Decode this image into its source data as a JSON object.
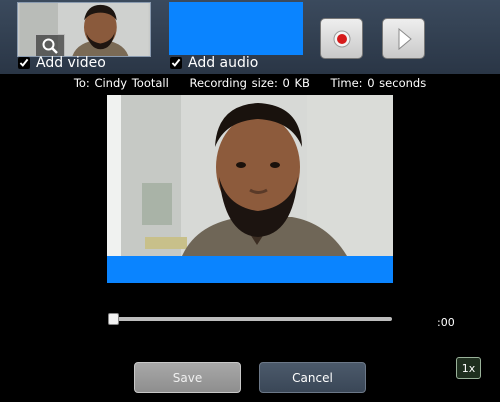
{
  "toolbar": {
    "add_video_label": "Add video",
    "add_audio_label": "Add audio",
    "add_video_checked": true,
    "add_audio_checked": true,
    "record_icon": "record-icon",
    "play_icon": "play-icon",
    "zoom_icon": "magnifier-icon"
  },
  "status": {
    "to": "To: Cindy Tootall",
    "size": "Recording size: 0 KB",
    "time": "Time: 0 seconds"
  },
  "player": {
    "time_label": ":00",
    "speed_label": "1x",
    "seek_progress": 0
  },
  "actions": {
    "save_label": "Save",
    "cancel_label": "Cancel"
  },
  "colors": {
    "accent_blue": "#0a84ff",
    "record_red": "#d61a1a",
    "topbar": "#334155"
  }
}
